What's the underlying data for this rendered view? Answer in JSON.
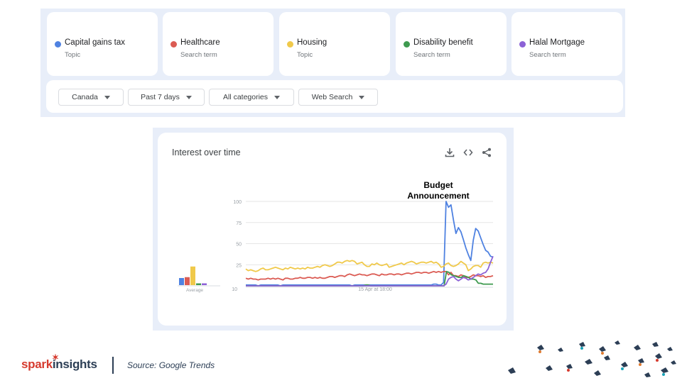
{
  "search_terms": [
    {
      "name": "Capital gains tax",
      "type": "Topic",
      "color": "#4f82e1"
    },
    {
      "name": "Healthcare",
      "type": "Search term",
      "color": "#db5b53"
    },
    {
      "name": "Housing",
      "type": "Topic",
      "color": "#f0c94a"
    },
    {
      "name": "Disability benefit",
      "type": "Search term",
      "color": "#3e9a4f"
    },
    {
      "name": "Halal Mortgage",
      "type": "Search term",
      "color": "#8c62d6"
    }
  ],
  "filters": {
    "region": "Canada",
    "time_range": "Past 7 days",
    "category": "All categories",
    "search_type": "Web Search"
  },
  "chart_card": {
    "title": "Interest over time",
    "icons": [
      "download-icon",
      "embed-code-icon",
      "share-icon"
    ],
    "annotation": "Budget Announcement"
  },
  "chart_data": {
    "type": "line",
    "title": "Interest over time",
    "ylim": [
      0,
      100
    ],
    "yticks": [
      "100",
      "75",
      "50",
      "25"
    ],
    "ytick_bottom_label": "10",
    "x_tick_labels": [
      "15 Apr at 18:00"
    ],
    "grid": true,
    "average_bars": {
      "label": "Average",
      "values": [
        8,
        9,
        21,
        2,
        2
      ]
    },
    "series": [
      {
        "name": "Capital gains tax",
        "color": "#4f82e1",
        "values": [
          1,
          1,
          1,
          1,
          1,
          0,
          1,
          1,
          1,
          1,
          1,
          1,
          1,
          1,
          0,
          1,
          1,
          1,
          1,
          1,
          1,
          1,
          1,
          1,
          1,
          1,
          1,
          1,
          1,
          1,
          1,
          1,
          1,
          1,
          1,
          1,
          1,
          1,
          1,
          1,
          1,
          1,
          1,
          0,
          1,
          1,
          1,
          1,
          1,
          1,
          1,
          1,
          1,
          1,
          1,
          1,
          1,
          1,
          1,
          1,
          1,
          1,
          1,
          1,
          1,
          1,
          1,
          1,
          1,
          1,
          1,
          1,
          1,
          1,
          1,
          1,
          2,
          2,
          1,
          1,
          4,
          100,
          93,
          96,
          78,
          62,
          69,
          64,
          55,
          45,
          37,
          30,
          54,
          68,
          65,
          57,
          49,
          42,
          40,
          35,
          34
        ]
      },
      {
        "name": "Healthcare",
        "color": "#db5b53",
        "values": [
          9,
          8,
          9,
          8,
          8,
          7,
          8,
          8,
          8,
          9,
          8,
          9,
          8,
          9,
          8,
          7,
          9,
          9,
          8,
          8,
          9,
          9,
          10,
          9,
          9,
          10,
          10,
          9,
          10,
          9,
          10,
          9,
          9,
          10,
          11,
          11,
          10,
          11,
          12,
          12,
          11,
          13,
          14,
          13,
          12,
          13,
          14,
          13,
          13,
          12,
          13,
          14,
          14,
          13,
          12,
          14,
          13,
          13,
          14,
          14,
          13,
          14,
          14,
          13,
          14,
          15,
          15,
          14,
          15,
          16,
          16,
          15,
          16,
          16,
          15,
          16,
          17,
          16,
          17,
          16,
          17,
          17,
          13,
          16,
          12,
          12,
          11,
          13,
          12,
          10,
          10,
          11,
          13,
          12,
          12,
          11,
          12,
          10,
          11,
          11,
          12
        ]
      },
      {
        "name": "Housing",
        "color": "#f0c94a",
        "values": [
          20,
          18,
          19,
          18,
          17,
          18,
          20,
          21,
          19,
          19,
          20,
          21,
          22,
          21,
          20,
          19,
          21,
          20,
          22,
          21,
          20,
          21,
          20,
          21,
          20,
          22,
          21,
          21,
          22,
          23,
          22,
          24,
          25,
          24,
          23,
          24,
          26,
          28,
          28,
          27,
          29,
          30,
          29,
          30,
          29,
          26,
          27,
          28,
          25,
          23,
          23,
          26,
          25,
          27,
          25,
          24,
          25,
          26,
          22,
          23,
          24,
          25,
          26,
          27,
          25,
          27,
          28,
          29,
          28,
          26,
          27,
          28,
          28,
          27,
          28,
          29,
          27,
          28,
          26,
          22,
          23,
          26,
          27,
          24,
          23,
          24,
          26,
          29,
          27,
          25,
          18,
          20,
          23,
          24,
          24,
          22,
          27,
          28,
          27,
          28,
          27
        ]
      },
      {
        "name": "Disability benefit",
        "color": "#3e9a4f",
        "values": [
          0,
          0,
          0,
          0,
          0,
          0,
          0,
          0,
          0,
          0,
          0,
          0,
          0,
          0,
          0,
          0,
          0,
          0,
          0,
          0,
          0,
          0,
          0,
          0,
          0,
          0,
          0,
          0,
          0,
          0,
          0,
          0,
          0,
          0,
          0,
          0,
          0,
          0,
          0,
          0,
          0,
          0,
          0,
          0,
          0,
          0,
          0,
          0,
          0,
          1,
          1,
          0,
          0,
          0,
          0,
          0,
          0,
          0,
          0,
          0,
          0,
          0,
          0,
          0,
          0,
          0,
          0,
          0,
          0,
          0,
          0,
          0,
          0,
          0,
          0,
          0,
          0,
          0,
          0,
          0,
          0,
          0,
          17,
          16,
          13,
          12,
          11,
          10,
          10,
          12,
          11,
          10,
          8,
          8,
          7,
          3,
          3,
          2,
          2,
          2,
          2,
          2
        ]
      },
      {
        "name": "Halal Mortgage",
        "color": "#8c62d6",
        "values": [
          0,
          0,
          0,
          0,
          0,
          0,
          0,
          0,
          0,
          0,
          0,
          0,
          0,
          0,
          0,
          0,
          0,
          0,
          0,
          0,
          0,
          0,
          0,
          0,
          0,
          0,
          0,
          0,
          0,
          0,
          0,
          0,
          0,
          0,
          0,
          0,
          0,
          0,
          0,
          0,
          0,
          0,
          0,
          0,
          0,
          0,
          0,
          0,
          0,
          0,
          0,
          0,
          0,
          0,
          0,
          0,
          0,
          0,
          0,
          0,
          0,
          0,
          0,
          0,
          0,
          0,
          0,
          0,
          0,
          0,
          0,
          0,
          0,
          0,
          0,
          0,
          0,
          0,
          0,
          0,
          0,
          2,
          8,
          10,
          11,
          8,
          6,
          8,
          10,
          9,
          7,
          8,
          10,
          12,
          14,
          13,
          15,
          16,
          20,
          28,
          35
        ]
      }
    ]
  },
  "footer": {
    "logo_part1": "spark",
    "logo_part2": "insights",
    "source": "Source: Google Trends"
  }
}
